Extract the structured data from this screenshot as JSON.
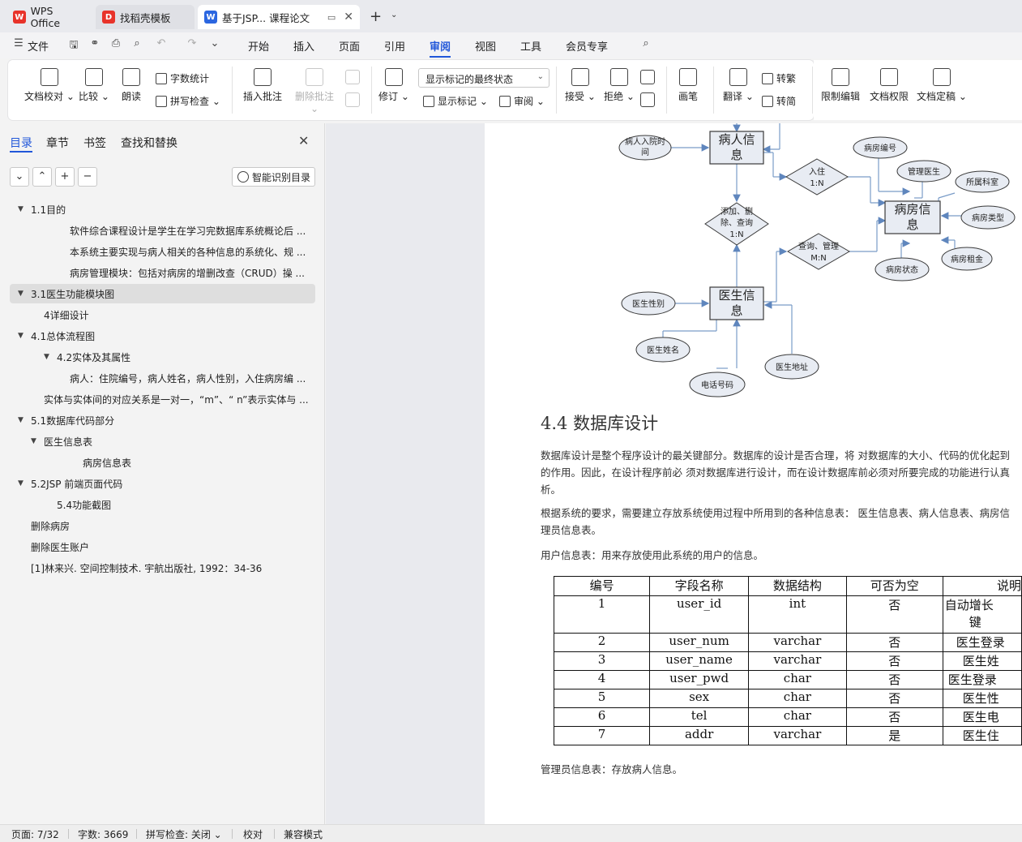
{
  "tabs": {
    "wps": "WPS Office",
    "templates": "找稻壳模板",
    "doc": "基于JSP... 课程论文"
  },
  "menu": {
    "file": "文件",
    "items": [
      "开始",
      "插入",
      "页面",
      "引用",
      "审阅",
      "视图",
      "工具",
      "会员专享"
    ],
    "active": "审阅"
  },
  "ribbon": {
    "doc_proofread": "文档校对",
    "compare": "比较",
    "read_aloud": "朗读",
    "word_count": "字数统计",
    "spell_check": "拼写检查",
    "insert_comment": "插入批注",
    "delete_comment": "删除批注",
    "track_changes": "修订",
    "markup_state": "显示标记的最终状态",
    "show_markup": "显示标记",
    "review": "审阅",
    "accept": "接受",
    "reject": "拒绝",
    "pen": "画笔",
    "translate": "翻译",
    "to_traditional": "转繁",
    "to_simplified": "转简",
    "restrict_edit": "限制编辑",
    "doc_permission": "文档权限",
    "doc_finalize": "文档定稿"
  },
  "nav": {
    "tabs": [
      "目录",
      "章节",
      "书签",
      "查找和替换"
    ],
    "smart_toc": "智能识别目录",
    "toc": [
      {
        "label": "1.1目的",
        "expand": "down"
      },
      {
        "label": "软件综合课程设计是学生在学习完数据库系统概论后 ...",
        "expand": ""
      },
      {
        "label": "本系统主要实现与病人相关的各种信息的系统化、规 ...",
        "expand": ""
      },
      {
        "label": "病房管理模块：包括对病房的增删改查（CRUD）操 ...",
        "expand": ""
      },
      {
        "label": "3.1医生功能模块图",
        "expand": "down"
      },
      {
        "label": "4详细设计",
        "expand": ""
      },
      {
        "label": "4.1总体流程图",
        "expand": "down"
      },
      {
        "label": "4.2实体及其属性",
        "expand": "down"
      },
      {
        "label": "病人：住院编号，病人姓名，病人性别，入住病房编 ...",
        "expand": ""
      },
      {
        "label": "实体与实体间的对应关系是一对一，“m”、“ n”表示实体与 ...",
        "expand": ""
      },
      {
        "label": "5.1数据库代码部分",
        "expand": "down"
      },
      {
        "label": "医生信息表",
        "expand": "down"
      },
      {
        "label": "病房信息表",
        "expand": ""
      },
      {
        "label": "5.2JSP 前端页面代码",
        "expand": "down"
      },
      {
        "label": "5.4功能截图",
        "expand": ""
      },
      {
        "label": "删除病房",
        "expand": ""
      },
      {
        "label": "删除医生账户",
        "expand": ""
      },
      {
        "label": "[1]林来兴. 空间控制技术. 宇航出版社, 1992：34-36",
        "expand": ""
      }
    ],
    "selected_index": 4
  },
  "diagram": {
    "entities": [
      "病人信息",
      "病房信息",
      "医生信息"
    ],
    "relations": [
      {
        "l1": "入住",
        "l2": "1:N"
      },
      {
        "l1": "添加、删",
        "l2": "除、查询",
        "l3": "1:N"
      },
      {
        "l1": "查询、管理",
        "l2": "M:N"
      }
    ],
    "attributes": [
      "病人入院时",
      "间",
      "病房编号",
      "管理医生",
      "所属科室",
      "病房类型",
      "病房租金",
      "病房状态",
      "医生性别",
      "医生姓名",
      "电话号码",
      "医生地址"
    ]
  },
  "document": {
    "heading": "4.4 数据库设计",
    "para1_l1": "数据库设计是整个程序设计的最关键部分。数据库的设计是否合理，将   对数据库的大小、代码的优化起到",
    "para1_l2": "的作用。因此，在设计程序前必   须对数据库进行设计，而在设计数据库前必须对所要完成的功能进行认真",
    "para1_l3": "析。",
    "para2_l1": "根据系统的要求，需要建立存放系统使用过程中所用到的各种信息表：   医生信息表、病人信息表、病房信",
    "para2_l2": "理员信息表。",
    "user_table_caption": "用户信息表：用来存放使用此系统的用户的信息。",
    "admin_table_caption": "管理员信息表：存放病人信息。",
    "table": {
      "headers": [
        "编号",
        "字段名称",
        "数据结构",
        "可否为空",
        "说明"
      ],
      "rows": [
        [
          "1",
          "user_id",
          "int",
          "否",
          "自动增长",
          "键"
        ],
        [
          "2",
          "user_num",
          "varchar",
          "否",
          "医生登录"
        ],
        [
          "3",
          "user_name",
          "varchar",
          "否",
          "医生姓"
        ],
        [
          "4",
          "user_pwd",
          "char",
          "否",
          "医生登录"
        ],
        [
          "5",
          "sex",
          "char",
          "否",
          "医生性"
        ],
        [
          "6",
          "tel",
          "char",
          "否",
          "医生电"
        ],
        [
          "7",
          "addr",
          "varchar",
          "是",
          "医生住"
        ]
      ]
    }
  },
  "status": {
    "page": "页面: 7/32",
    "words": "字数: 3669",
    "spell": "拼写检查: 关闭",
    "proofread": "校对",
    "compat": "兼容模式"
  },
  "colors": {
    "accent": "#2157d9",
    "entity_fill": "#e8ecf3",
    "attr_fill": "#e8ecf3",
    "line": "#7a9cc8"
  }
}
